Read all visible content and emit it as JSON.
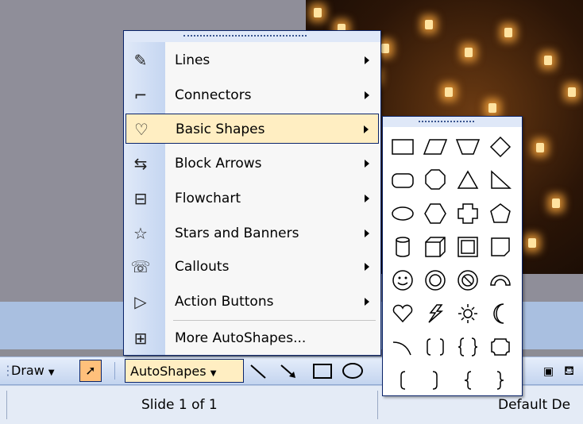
{
  "toolbar": {
    "draw_label": "Draw",
    "autoshapes_label": "AutoShapes",
    "draw_tools": [
      "line-tool-icon",
      "arrow-tool-icon",
      "rectangle-tool-icon",
      "oval-tool-icon"
    ]
  },
  "menu": {
    "items": [
      {
        "label": "Lines",
        "icon": "lines-icon",
        "submenu": true
      },
      {
        "label": "Connectors",
        "icon": "connectors-icon",
        "submenu": true
      },
      {
        "label": "Basic Shapes",
        "icon": "basic-shapes-icon",
        "submenu": true,
        "highlighted": true
      },
      {
        "label": "Block Arrows",
        "icon": "block-arrows-icon",
        "submenu": true
      },
      {
        "label": "Flowchart",
        "icon": "flowchart-icon",
        "submenu": true
      },
      {
        "label": "Stars and Banners",
        "icon": "stars-banners-icon",
        "submenu": true
      },
      {
        "label": "Callouts",
        "icon": "callouts-icon",
        "submenu": true
      },
      {
        "label": "Action Buttons",
        "icon": "action-buttons-icon",
        "submenu": true
      },
      {
        "label": "More AutoShapes...",
        "icon": "more-autoshapes-icon",
        "submenu": false
      }
    ]
  },
  "palette": {
    "shapes": [
      [
        "rectangle",
        "parallelogram",
        "trapezoid",
        "diamond"
      ],
      [
        "rounded-rectangle",
        "octagon",
        "triangle",
        "right-triangle"
      ],
      [
        "oval",
        "hexagon",
        "cross",
        "pentagon"
      ],
      [
        "can",
        "cube",
        "bevel",
        "folded-corner"
      ],
      [
        "smiley-face",
        "donut",
        "no-symbol",
        "block-arc"
      ],
      [
        "heart",
        "lightning-bolt",
        "sun",
        "moon"
      ],
      [
        "arc",
        "double-bracket",
        "double-brace",
        "plaque"
      ],
      [
        "left-bracket",
        "right-bracket",
        "left-brace",
        "right-brace"
      ]
    ]
  },
  "status": {
    "slide": "Slide 1 of 1",
    "design": "Default De"
  },
  "colors": {
    "menu_highlight": "#ffeec2",
    "menu_border": "#0a246a",
    "toolbar_bg": "#c3d4ef",
    "workspace": "#8f8e99"
  }
}
